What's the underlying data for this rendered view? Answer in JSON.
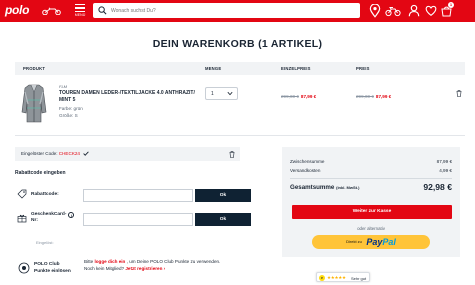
{
  "header": {
    "logo": "polo",
    "menu_label": "MENÜ",
    "search_placeholder": "Wonach suchst Du?",
    "cart_count": "1"
  },
  "page": {
    "title": "DEIN WARENKORB (1 ARTIKEL)"
  },
  "table": {
    "columns": [
      "PRODUKT",
      "MENGE",
      "EINZELPREIS",
      "PREIS"
    ],
    "row": {
      "brand": "FLM",
      "name": "TOUREN DAMEN LEDER-/TEXTILJACKE 4.0 ANTHRAZIT/ MINT 5",
      "color": "Farbe: grün",
      "size": "Größe: S",
      "quantity": "1",
      "unit_old": "299,00 €",
      "unit_new": "87,99 €",
      "total_old": "299,00 €",
      "total_new": "87,99 €"
    }
  },
  "coupon": {
    "prefix": "Eingelöster Code: ",
    "code": "CHECK24"
  },
  "discount": {
    "title": "Rabattcode eingeben",
    "code_label": "Rabattcode:",
    "gift_label_1": "GeschenkCard-",
    "gift_label_2": "Nr:",
    "ok": "Ok",
    "redeemed": "Eingelöst:"
  },
  "club": {
    "label_1": "POLO Club",
    "label_2": "Punkte einlösen",
    "text_1": "Bitte ",
    "login_link": "logge dich ein",
    "text_2": " , um Deine POLO Club Punkte zu verwenden.",
    "text_3": "Noch kein Mitglied? ",
    "register_link": "Jetzt registrieren ›"
  },
  "summary": {
    "subtotal_label": "Zwischensumme",
    "subtotal": "87,99 €",
    "shipping_label": "Versandkosten",
    "shipping": "4,99 €",
    "total_label": "Gesamtsumme",
    "total_note": "(inkl. MwSt.)",
    "total": "92,98 €",
    "checkout": "Weiter zur Kasse",
    "alt": "oder alternativ",
    "paypal_prefix": "Direkt zu",
    "paypal_1": "Pay",
    "paypal_2": "Pal"
  },
  "trust": {
    "rating_label": "Sehr gut",
    "stars": "★★★★★"
  },
  "colors": {
    "brand_red": "#e30613",
    "dark": "#0f2233",
    "paypal_yellow": "#ffc439"
  }
}
